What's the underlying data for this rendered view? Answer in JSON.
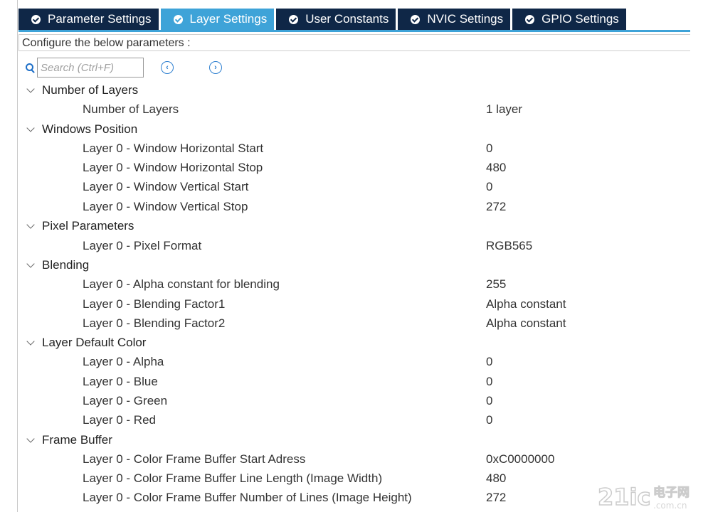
{
  "tabs": [
    {
      "label": "Parameter Settings",
      "active": false,
      "icon": "check-circle-icon"
    },
    {
      "label": "Layer Settings",
      "active": true,
      "icon": "check-circle-icon"
    },
    {
      "label": "User Constants",
      "active": false,
      "icon": "check-circle-icon"
    },
    {
      "label": "NVIC Settings",
      "active": false,
      "icon": "check-circle-icon"
    },
    {
      "label": "GPIO Settings",
      "active": false,
      "icon": "check-circle-icon"
    }
  ],
  "configure_label": "Configure the below parameters :",
  "search": {
    "placeholder": "Search (Ctrl+F)",
    "value": "",
    "prev_icon": "chevron-left-circle-icon",
    "next_icon": "chevron-right-circle-icon"
  },
  "groups": [
    {
      "label": "Number of Layers",
      "params": [
        {
          "name": "Number of Layers",
          "value": "1 layer"
        }
      ]
    },
    {
      "label": "Windows Position",
      "params": [
        {
          "name": "Layer 0 - Window Horizontal Start",
          "value": "0"
        },
        {
          "name": "Layer 0 - Window Horizontal Stop",
          "value": "480"
        },
        {
          "name": "Layer 0 - Window Vertical Start",
          "value": "0"
        },
        {
          "name": "Layer 0 - Window Vertical Stop",
          "value": "272"
        }
      ]
    },
    {
      "label": "Pixel Parameters",
      "params": [
        {
          "name": "Layer 0 - Pixel Format",
          "value": "RGB565"
        }
      ]
    },
    {
      "label": "Blending",
      "params": [
        {
          "name": "Layer 0 - Alpha constant for blending",
          "value": "255"
        },
        {
          "name": "Layer 0 - Blending Factor1",
          "value": "Alpha constant"
        },
        {
          "name": "Layer 0 - Blending Factor2",
          "value": "Alpha constant"
        }
      ]
    },
    {
      "label": "Layer Default Color",
      "params": [
        {
          "name": "Layer 0 - Alpha",
          "value": "0"
        },
        {
          "name": "Layer 0 - Blue",
          "value": "0"
        },
        {
          "name": "Layer 0 - Green",
          "value": "0"
        },
        {
          "name": "Layer 0 - Red",
          "value": "0"
        }
      ]
    },
    {
      "label": "Frame Buffer",
      "params": [
        {
          "name": "Layer 0 - Color Frame Buffer Start Adress",
          "value": "0xC0000000"
        },
        {
          "name": "Layer 0 - Color Frame Buffer Line Length (Image Width)",
          "value": "480"
        },
        {
          "name": "Layer 0 - Color Frame Buffer Number of Lines (Image Height)",
          "value": "272"
        }
      ]
    }
  ],
  "watermark": {
    "text": "21ic 电子网"
  },
  "colors": {
    "tab_dark": "#0f2747",
    "tab_active": "#3ea3d8",
    "accent": "#2d7fd0"
  }
}
